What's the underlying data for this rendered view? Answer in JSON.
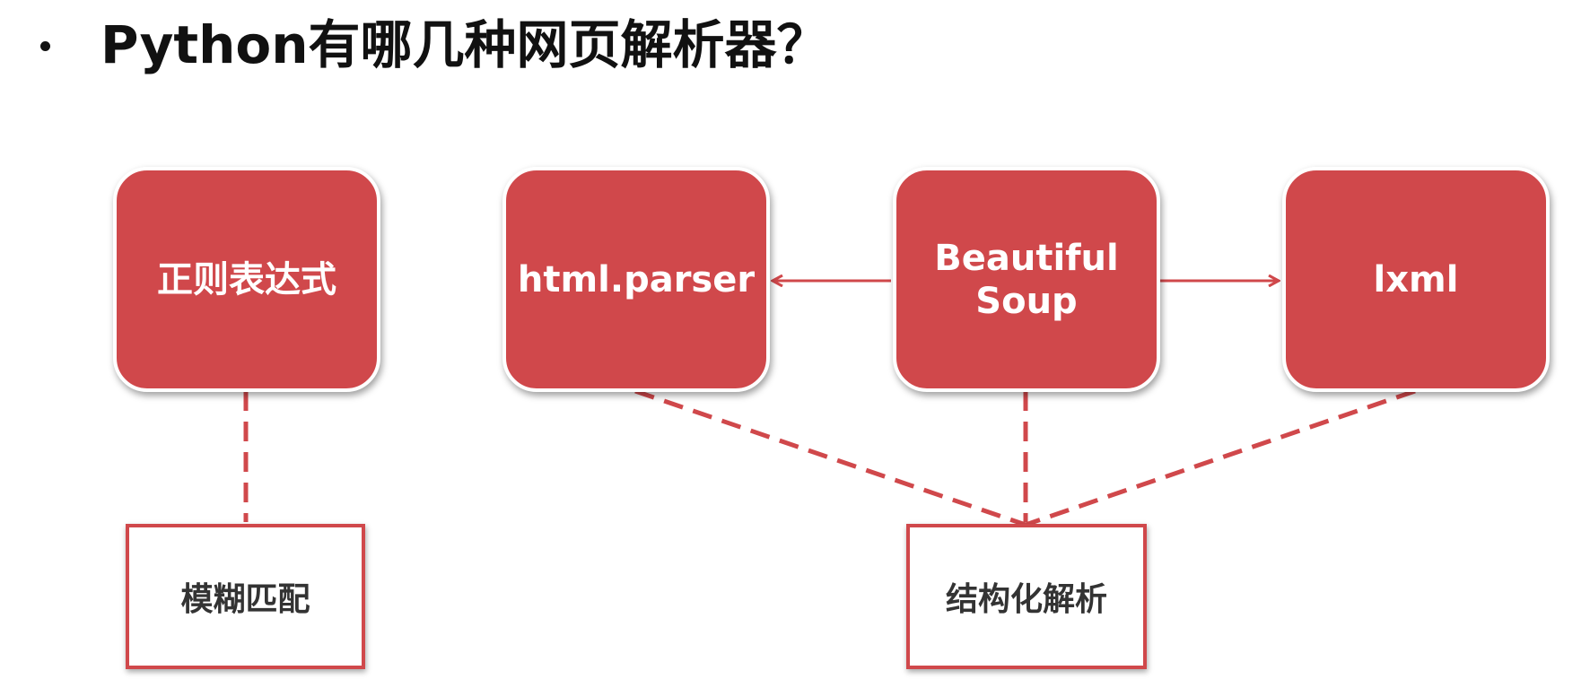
{
  "slide": {
    "title": "Python有哪几种网页解析器？"
  },
  "diagram": {
    "nodes": {
      "regex": "正则表达式",
      "html_parser": "html.parser",
      "beautiful_soup_line1": "Beautiful",
      "beautiful_soup_line2": "Soup",
      "lxml": "lxml",
      "fuzzy_match": "模糊匹配",
      "structured_parse": "结构化解析"
    },
    "edges": [
      {
        "from": "regex",
        "to": "fuzzy_match",
        "style": "dashed"
      },
      {
        "from": "beautiful_soup",
        "to": "html_parser",
        "style": "arrow"
      },
      {
        "from": "beautiful_soup",
        "to": "lxml",
        "style": "arrow"
      },
      {
        "from": "html_parser",
        "to": "structured_parse",
        "style": "dashed"
      },
      {
        "from": "beautiful_soup",
        "to": "structured_parse",
        "style": "dashed"
      },
      {
        "from": "lxml",
        "to": "structured_parse",
        "style": "dashed"
      }
    ]
  },
  "colors": {
    "accent": "#d0484b",
    "title_text": "#111111",
    "box_text": "#333333"
  }
}
